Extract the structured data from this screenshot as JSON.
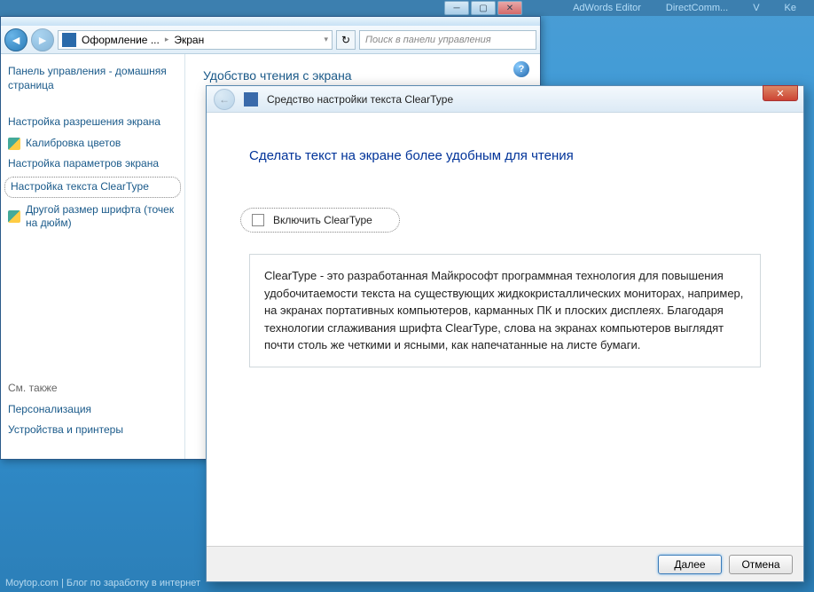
{
  "taskbar": {
    "items": [
      "AdWords Editor",
      "DirectComm...",
      "V",
      "Ke"
    ]
  },
  "window_controls": {
    "minimize": "─",
    "maximize": "▢",
    "close": "✕"
  },
  "explorer": {
    "nav": {
      "back_glyph": "◄",
      "fwd_glyph": "►",
      "refresh_glyph": "↻",
      "breadcrumb": [
        "Оформление ...",
        "Экран"
      ],
      "sep": "▸",
      "dropdown_glyph": "▾"
    },
    "search": {
      "placeholder": "Поиск в панели управления"
    },
    "sidebar": {
      "home": "Панель управления - домашняя страница",
      "links": [
        {
          "label": "Настройка разрешения экрана",
          "shield": false,
          "hl": false
        },
        {
          "label": "Калибровка цветов",
          "shield": true,
          "hl": false
        },
        {
          "label": "Настройка параметров экрана",
          "shield": false,
          "hl": false
        },
        {
          "label": "Настройка текста ClearType",
          "shield": false,
          "hl": true
        },
        {
          "label": "Другой размер шрифта (точек на дюйм)",
          "shield": true,
          "hl": false
        }
      ],
      "see_also": "См. также",
      "footer_links": [
        "Персонализация",
        "Устройства и принтеры"
      ]
    },
    "content": {
      "title": "Удобство чтения с экрана",
      "help_glyph": "?"
    }
  },
  "wizard": {
    "title": "Средство настройки текста ClearType",
    "back_glyph": "←",
    "close_glyph": "✕",
    "heading": "Сделать текст на экране более удобным для чтения",
    "checkbox_label": "Включить ClearType",
    "description": "ClearType - это разработанная Майкрософт программная технология для повышения удобочитаемости текста на существующих жидкокристаллических мониторах, например, на экранах портативных компьютеров, карманных ПК и плоских дисплеях. Благодаря технологии сглаживания шрифта ClearType, слова на экранах компьютеров выглядят почти столь же четкими и ясными, как напечатанные на листе бумаги.",
    "buttons": {
      "next": "Далее",
      "cancel": "Отмена"
    }
  },
  "page_footer": "Moytop.com | Блог по заработку в интернет"
}
